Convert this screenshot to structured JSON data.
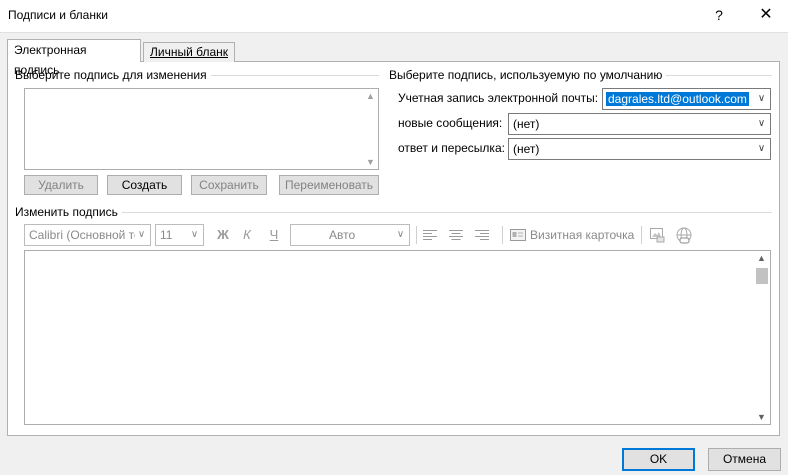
{
  "window": {
    "title": "Подписи и бланки",
    "help_glyph": "?",
    "close_glyph": "✕"
  },
  "tabs": [
    {
      "label": "Электронная подпись",
      "active": true
    },
    {
      "label": "Личный бланк",
      "active": false
    }
  ],
  "select_signature": {
    "label": "Выберите подпись для изменения",
    "items": [],
    "buttons": {
      "delete": "Удалить",
      "create": "Создать",
      "save": "Сохранить",
      "rename": "Переименовать"
    }
  },
  "default_signature": {
    "label": "Выберите подпись, используемую по умолчанию",
    "account_label": "Учетная запись электронной почты:",
    "account_value": "dagrales.ltd@outlook.com",
    "new_messages_label": "новые сообщения:",
    "new_messages_value": "(нет)",
    "replies_label": "ответ и пересылка:",
    "replies_value": "(нет)"
  },
  "edit_signature": {
    "label": "Изменить подпись",
    "font_value": "Calibri (Основной те",
    "size_value": "11",
    "bold": "Ж",
    "italic": "К",
    "underline": "Ч",
    "color_value": "Авто",
    "business_card": "Визитная карточка"
  },
  "footer": {
    "ok": "OK",
    "cancel": "Отмена"
  },
  "colors": {
    "accent": "#0078d7",
    "dialog_bg": "#f0f0f0"
  }
}
